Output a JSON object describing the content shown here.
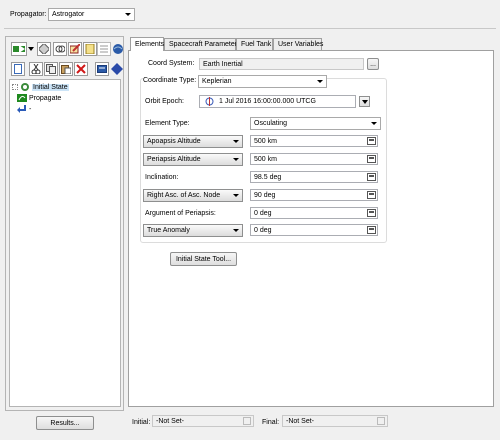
{
  "top": {
    "propagator_label": "Propagator:",
    "propagator_value": "Astrogator"
  },
  "toolbar": {
    "row1_icons": [
      "insert-segment-icon",
      "dropdown-arrow-icon",
      "component-icon",
      "link-icon",
      "edit-icon",
      "notes-icon",
      "list-icon",
      "globe-icon"
    ],
    "row2_icons": [
      "new-icon",
      "cut-icon",
      "copy-icon",
      "paste-icon",
      "delete-icon",
      "report-icon",
      "run-icon"
    ]
  },
  "tree": {
    "items": [
      {
        "label": "Initial State",
        "icon": "initial-state-icon"
      },
      {
        "label": "Propagate",
        "icon": "propagate-icon"
      },
      {
        "label": "-",
        "icon": "return-arrow-icon"
      }
    ]
  },
  "results_button": "Results...",
  "tabs": [
    "Elements",
    "Spacecraft Parameters",
    "Fuel Tank",
    "User Variables"
  ],
  "form": {
    "coord_system_label": "Coord System:",
    "coord_system_value": "Earth Inertial",
    "coord_system_btn": "...",
    "coord_type_label": "Coordinate Type:",
    "coord_type_value": "Keplerian",
    "orbit_epoch_label": "Orbit Epoch:",
    "orbit_epoch_value": "1 Jul 2016 16:00:00.000 UTCG",
    "element_type_label": "Element Type:",
    "element_type_value": "Osculating",
    "rows": [
      {
        "label": "Apoapsis Altitude",
        "selectable": true,
        "value": "500 km"
      },
      {
        "label": "Periapsis Altitude",
        "selectable": true,
        "value": "500 km"
      },
      {
        "label": "Inclination:",
        "selectable": false,
        "value": "98.5 deg"
      },
      {
        "label": "Right Asc. of Asc. Node",
        "selectable": true,
        "value": "90 deg"
      },
      {
        "label": "Argument of Periapsis:",
        "selectable": false,
        "value": "0 deg"
      },
      {
        "label": "True Anomaly",
        "selectable": true,
        "value": "0 deg"
      }
    ],
    "initial_state_tool": "Initial State Tool..."
  },
  "bottom": {
    "initial_label": "Initial:",
    "initial_value": "-Not Set-",
    "final_label": "Final:",
    "final_value": "-Not Set-"
  }
}
